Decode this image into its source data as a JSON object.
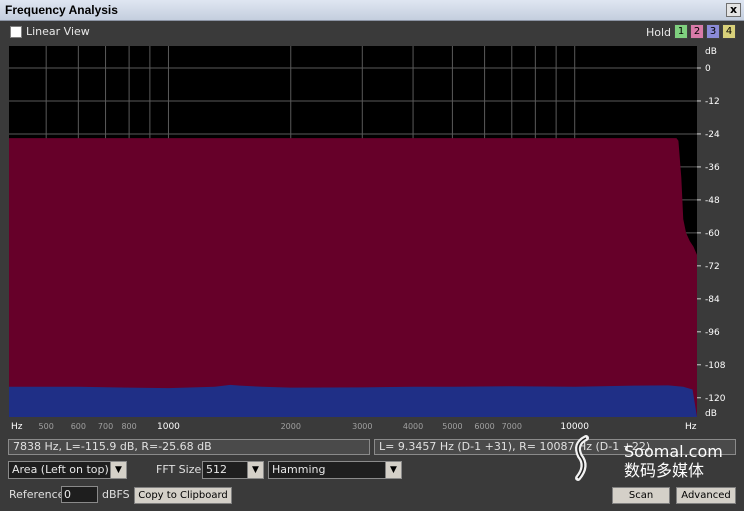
{
  "window": {
    "title": "Frequency Analysis",
    "close_label": "x"
  },
  "top_bar": {
    "linear_view_label": "Linear View",
    "hold_label": "Hold",
    "hold_buttons": [
      {
        "label": "1",
        "color": "#7fd07f"
      },
      {
        "label": "2",
        "color": "#d87aa8"
      },
      {
        "label": "3",
        "color": "#8a8ad8"
      },
      {
        "label": "4",
        "color": "#d8d07a"
      }
    ]
  },
  "chart_data": {
    "type": "area",
    "x_scale": "log",
    "x_unit_label": "Hz",
    "y_unit_label": "dB",
    "xlim": [
      405,
      20000
    ],
    "ylim": [
      -127,
      8
    ],
    "x_tick_labels": [
      {
        "value": 500,
        "label": "500"
      },
      {
        "value": 600,
        "label": "600"
      },
      {
        "value": 700,
        "label": "700"
      },
      {
        "value": 800,
        "label": "800"
      },
      {
        "value": 1000,
        "label": "1000"
      },
      {
        "value": 2000,
        "label": "2000"
      },
      {
        "value": 3000,
        "label": "3000"
      },
      {
        "value": 4000,
        "label": "4000"
      },
      {
        "value": 5000,
        "label": "5000"
      },
      {
        "value": 6000,
        "label": "6000"
      },
      {
        "value": 7000,
        "label": "7000"
      },
      {
        "value": 10000,
        "label": "10000"
      }
    ],
    "x_gridlines": [
      500,
      600,
      700,
      800,
      900,
      1000,
      2000,
      3000,
      4000,
      5000,
      6000,
      7000,
      8000,
      9000,
      10000
    ],
    "y_ticks": [
      0,
      -12,
      -24,
      -36,
      -48,
      -60,
      -72,
      -84,
      -96,
      -108,
      -120
    ],
    "y_tick_labels": [
      "0",
      "-12",
      "-24",
      "-36",
      "-48",
      "-60",
      "-72",
      "-84",
      "-96",
      "-108",
      "-120"
    ],
    "series": [
      {
        "color": "#660029",
        "points": [
          [
            405,
            -25.5
          ],
          [
            1000,
            -25.5
          ],
          [
            5000,
            -25.5
          ],
          [
            10000,
            -25.5
          ],
          [
            17800,
            -25.5
          ],
          [
            18000,
            -26.5
          ],
          [
            18300,
            -40
          ],
          [
            18500,
            -55
          ],
          [
            18800,
            -60
          ],
          [
            19200,
            -63
          ],
          [
            19600,
            -65
          ],
          [
            20000,
            -68
          ]
        ]
      },
      {
        "color": "#1f2f86",
        "points": [
          [
            405,
            -116
          ],
          [
            600,
            -116
          ],
          [
            800,
            -116.3
          ],
          [
            1000,
            -116.5
          ],
          [
            1300,
            -116
          ],
          [
            1420,
            -115.3
          ],
          [
            1500,
            -115.6
          ],
          [
            1700,
            -116
          ],
          [
            2000,
            -116.3
          ],
          [
            3000,
            -116.2
          ],
          [
            4000,
            -116
          ],
          [
            5000,
            -116
          ],
          [
            7000,
            -115.8
          ],
          [
            10000,
            -116
          ],
          [
            14000,
            -115.6
          ],
          [
            17000,
            -115.5
          ],
          [
            18500,
            -116
          ],
          [
            19500,
            -117
          ],
          [
            20000,
            -127
          ]
        ]
      }
    ]
  },
  "status": {
    "left": "7838 Hz, L=-115.9 dB, R=-25.68 dB",
    "right": "L= 9.3457 Hz (D-1 +31), R= 10087 Hz (D-1 +22)"
  },
  "controls": {
    "mode_value": "Area (Left on top)",
    "fft_size_label": "FFT Size",
    "fft_size_value": "512",
    "window_value": "Hamming",
    "reference_label": "Reference",
    "reference_value": "0",
    "reference_unit": "dBFS",
    "copy_button_label": "Copy to Clipboard",
    "scan_button_label": "Scan",
    "advanced_button_label": "Advanced"
  },
  "watermark": {
    "line1": "Soomal.com",
    "line2": "数码多媒体"
  }
}
